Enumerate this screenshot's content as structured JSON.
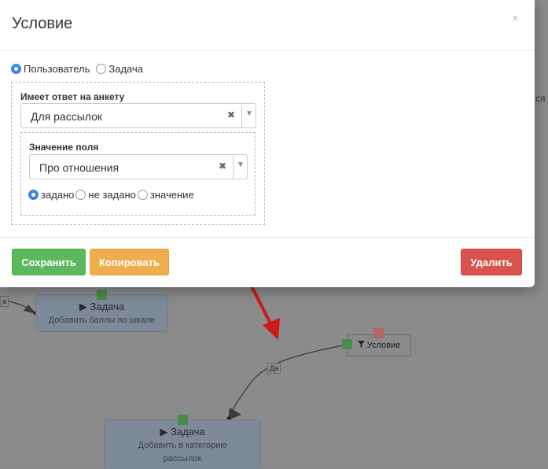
{
  "modal": {
    "title": "Условие",
    "close_icon": "×",
    "target_radios": [
      {
        "label": "Пользователь",
        "checked": true
      },
      {
        "label": "Задача",
        "checked": false
      }
    ],
    "survey_field": {
      "label": "Имеет ответ на анкету",
      "value": "Для рассылок"
    },
    "field_value": {
      "label": "Значение поля",
      "value": "Про отношения",
      "radios": [
        {
          "label": "задано",
          "checked": true
        },
        {
          "label": "не задано",
          "checked": false
        },
        {
          "label": "значение",
          "checked": false
        }
      ]
    },
    "buttons": {
      "save": "Сохранить",
      "copy": "Копировать",
      "delete": "Удалить"
    }
  },
  "canvas": {
    "node_task1": {
      "title": "▶ Задача",
      "desc": "Добавить баллы по шкале"
    },
    "node_task2": {
      "title": "▶ Задача",
      "desc_line1": "Добавить в категорию",
      "desc_line2": "рассылок"
    },
    "node_condition": {
      "title": "Условие"
    },
    "edge_label_yes": "Да",
    "edge_label_left": "а",
    "bg_text_stub": "ся"
  },
  "colors": {
    "primary": "#3a85e8",
    "success": "#5cb85c",
    "warning": "#f0ad4e",
    "danger": "#d9534f",
    "annotation_arrow": "#cc1a1a"
  }
}
